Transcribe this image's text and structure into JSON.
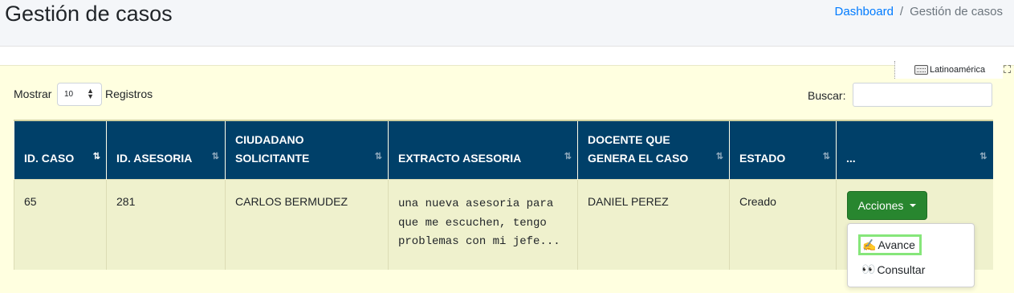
{
  "header": {
    "title": "Gestión de casos",
    "breadcrumb": {
      "home": "Dashboard",
      "current": "Gestión de casos"
    }
  },
  "keyboard_tool": {
    "label": "Latinoamérica"
  },
  "controls": {
    "show_label": "Mostrar",
    "page_size": "10",
    "records_label": "Registros",
    "search_label": "Buscar:",
    "search_value": ""
  },
  "table": {
    "columns": [
      "ID. CASO",
      "ID. ASESORIA",
      "CIUDADANO SOLICITANTE",
      "EXTRACTO ASESORIA",
      "DOCENTE QUE GENERA EL CASO",
      "ESTADO",
      "..."
    ],
    "rows": [
      {
        "id_caso": "65",
        "id_asesoria": "281",
        "ciudadano": "CARLOS BERMUDEZ",
        "extracto": "una nueva asesoria para que me escuchen, tengo problemas con mi jefe...",
        "docente": "DANIEL PEREZ",
        "estado": "Creado"
      }
    ]
  },
  "actions": {
    "button_label": "Acciones",
    "menu": [
      {
        "icon": "writing-hand-icon",
        "label": "Avance"
      },
      {
        "icon": "eyes-icon",
        "label": "Consultar"
      }
    ]
  },
  "colors": {
    "header_bg": "#004069",
    "button_green": "#28862f",
    "highlight": "#86e67a",
    "link": "#007bff"
  }
}
